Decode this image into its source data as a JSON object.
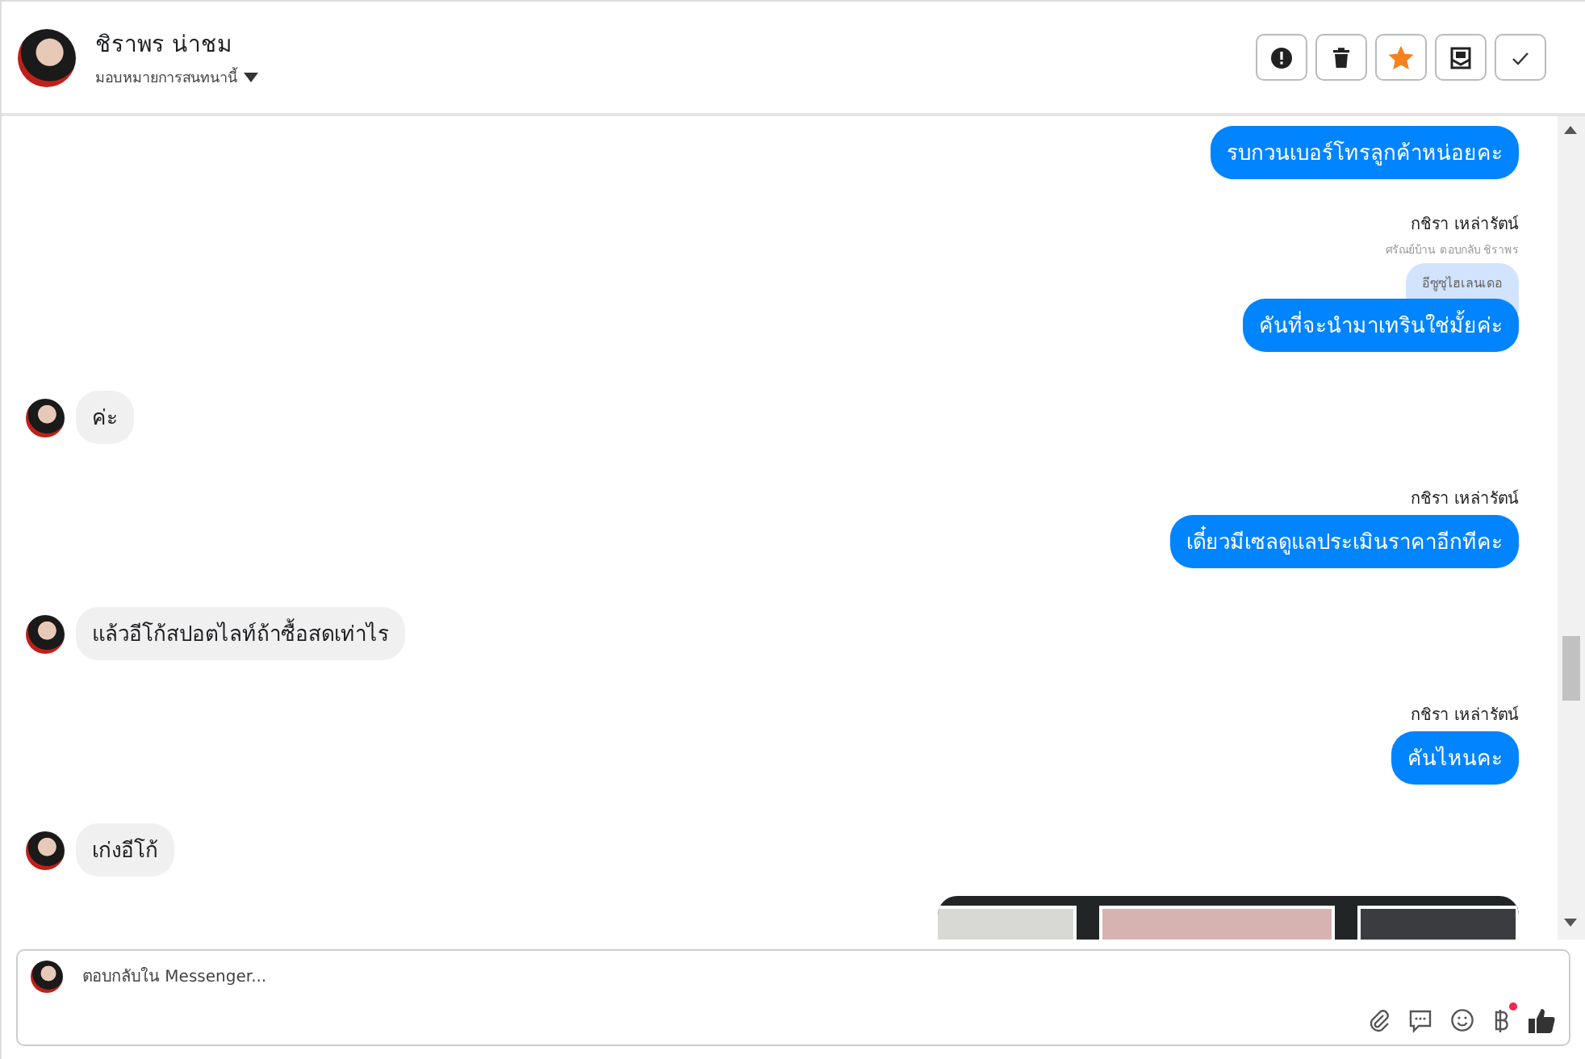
{
  "header": {
    "name": "ชิราพร น่าชม",
    "assign": "มอบหมายการสนทนานี้",
    "actions": [
      {
        "kind": "alert"
      },
      {
        "kind": "trash"
      },
      {
        "kind": "star",
        "on": true
      },
      {
        "kind": "mail"
      },
      {
        "kind": "check"
      }
    ]
  },
  "messages": [
    {
      "kind": "outgoing",
      "text": "รบกวนเบอร์โทรลูกค้าหน่อยคะ"
    },
    {
      "kind": "outgoing",
      "sender": "กชิรา เหล่ารัตน์",
      "reply_context": "ศรัณย์บ้าน ตอบกลับ ชิราพร",
      "quoted": "อีซูซุไฮเลนเดอ",
      "text": "คันที่จะนำมาเทรินใช่มั้ยค่ะ"
    },
    {
      "kind": "incoming",
      "text": "ค่ะ"
    },
    {
      "kind": "outgoing",
      "sender": "กชิรา เหล่ารัตน์",
      "text": "เดี๋ยวมีเซลดูแลประเมินราคาอีกทีคะ"
    },
    {
      "kind": "incoming",
      "text": "แล้วอีโก้สปอตไลท์ถ้าซื้อสดเท่าไร"
    },
    {
      "kind": "outgoing",
      "sender": "กชิรา เหล่ารัตน์",
      "text": "คันไหนคะ"
    },
    {
      "kind": "incoming",
      "text": "เก่งอีโก้"
    },
    {
      "kind": "image"
    }
  ],
  "composer": {
    "placeholder": "ตอบกลับใน Messenger..."
  }
}
